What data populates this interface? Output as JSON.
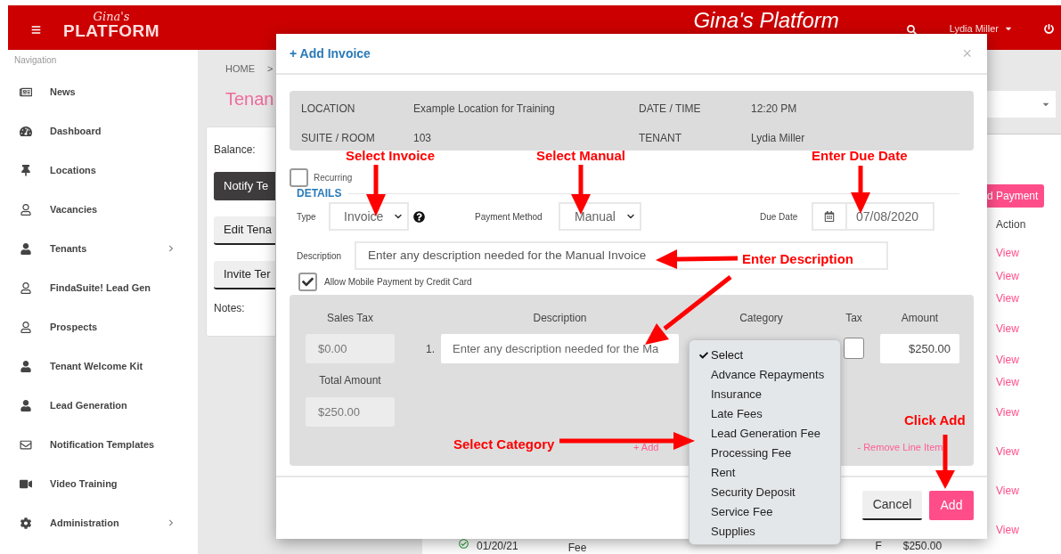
{
  "header": {
    "logo_script": "Gina's",
    "logo_word": "PLATFORM",
    "title": "Gina's Platform",
    "user": "Lydia Miller"
  },
  "sidebar": {
    "heading": "Navigation",
    "items": [
      {
        "label": "News",
        "expandable": false
      },
      {
        "label": "Dashboard",
        "expandable": false
      },
      {
        "label": "Locations",
        "expandable": false
      },
      {
        "label": "Vacancies",
        "expandable": false
      },
      {
        "label": "Tenants",
        "expandable": true
      },
      {
        "label": "FindaSuite! Lead Gen",
        "expandable": false
      },
      {
        "label": "Prospects",
        "expandable": false
      },
      {
        "label": "Tenant Welcome Kit",
        "expandable": false
      },
      {
        "label": "Lead Generation",
        "expandable": false
      },
      {
        "label": "Notification Templates",
        "expandable": false
      },
      {
        "label": "Video Training",
        "expandable": false
      },
      {
        "label": "Administration",
        "expandable": true
      }
    ]
  },
  "background": {
    "breadcrumb": [
      "HOME",
      ">"
    ],
    "page_title": "Tenan",
    "balance_label": "Balance:",
    "buttons": [
      {
        "label": "Notify Te",
        "kind": "dark"
      },
      {
        "label": "Edit Tena",
        "kind": "light"
      },
      {
        "label": "Invite Ter",
        "kind": "light"
      }
    ],
    "notes_label": "Notes:",
    "payment_button": "d Payment",
    "action_header": "Action",
    "view_links": [
      "View",
      "View",
      "View",
      "View",
      "View",
      "View",
      "View",
      "View",
      "View",
      "View"
    ],
    "last_row": {
      "date": "01/20/21",
      "category": "Fee",
      "tax": "F",
      "amount": "$250.00"
    }
  },
  "modal": {
    "title": "+ Add Invoice",
    "close": "×",
    "info": [
      {
        "label": "LOCATION",
        "value": "Example Location for Training"
      },
      {
        "label": "DATE / TIME",
        "value": "12:20 PM"
      },
      {
        "label": "SUITE / ROOM",
        "value": "103"
      },
      {
        "label": "TENANT",
        "value": "Lydia Miller"
      }
    ],
    "recurring": {
      "label": "Recurring",
      "checked": false
    },
    "section": "DETAILS",
    "type": {
      "label": "Type",
      "value": "Invoice"
    },
    "payment_method": {
      "label": "Payment Method",
      "value": "Manual"
    },
    "due_date": {
      "label": "Due Date",
      "value": "07/08/2020"
    },
    "description": {
      "label": "Description",
      "value": "Enter any description needed for the Manual Invoice"
    },
    "mobile_payment": {
      "label": "Allow Mobile Payment by Credit Card",
      "checked": true
    },
    "line_items": {
      "sales_tax_label": "Sales Tax",
      "sales_tax": "$0.00",
      "total_label": "Total Amount",
      "total": "$250.00",
      "columns": [
        "Description",
        "Category",
        "Tax",
        "Amount"
      ],
      "rows": [
        {
          "number": "1.",
          "description": "Enter any description needed for the Ma",
          "tax": false,
          "amount": "$250.00"
        }
      ],
      "add_link": "+ Add",
      "remove_link": "- Remove Line Item"
    },
    "buttons": {
      "cancel": "Cancel",
      "add": "Add"
    }
  },
  "category_dropdown": {
    "options": [
      {
        "label": "Select",
        "selected": true
      },
      {
        "label": "Advance Repayments",
        "selected": false
      },
      {
        "label": "Insurance",
        "selected": false
      },
      {
        "label": "Late Fees",
        "selected": false
      },
      {
        "label": "Lead Generation Fee",
        "selected": false
      },
      {
        "label": "Processing Fee",
        "selected": false
      },
      {
        "label": "Rent",
        "selected": false
      },
      {
        "label": "Security Deposit",
        "selected": false
      },
      {
        "label": "Service Fee",
        "selected": false
      },
      {
        "label": "Supplies",
        "selected": false
      }
    ]
  },
  "annotations": [
    {
      "text": "Select Invoice"
    },
    {
      "text": "Select Manual"
    },
    {
      "text": "Enter Due Date"
    },
    {
      "text": "Enter Description"
    },
    {
      "text": "Select Category"
    },
    {
      "text": "Click Add"
    }
  ]
}
